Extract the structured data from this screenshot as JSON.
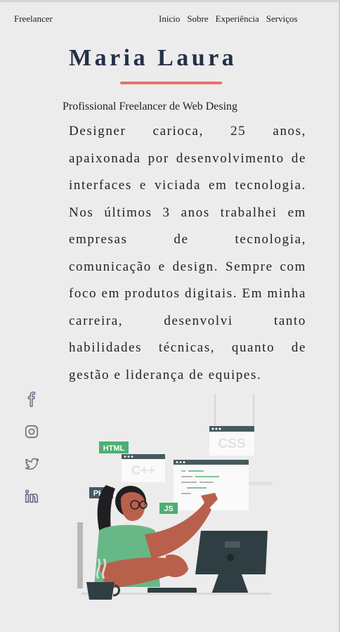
{
  "nav": {
    "brand": "Freelancer",
    "links": [
      "Inicio",
      "Sobre",
      "Experiência",
      "Serviços"
    ]
  },
  "hero": {
    "name": "Maria Laura",
    "subtitle": "Profissional Freelancer de Web Desing",
    "about": "Designer carioca, 25 anos, apaixonada por desenvolvimento de interfaces e viciada em tecnologia. Nos últimos 3 anos trabalhei em empresas de tecnologia, comunicação e design. Sempre com foco em produtos digitais. Em minha carreira, desenvolvi tanto habilidades técnicas, quanto de gestão e liderança de equipes."
  },
  "social": [
    {
      "icon": "facebook-icon"
    },
    {
      "icon": "instagram-icon"
    },
    {
      "icon": "twitter-icon"
    },
    {
      "icon": "linkedin-icon"
    }
  ],
  "illustration": {
    "tags": [
      "HTML",
      "C++",
      "CSS",
      "PHP",
      "JS"
    ]
  },
  "colors": {
    "background": "#ececec",
    "heading": "#243047",
    "accent": "#ef7063",
    "icon": "#6b6f86"
  }
}
